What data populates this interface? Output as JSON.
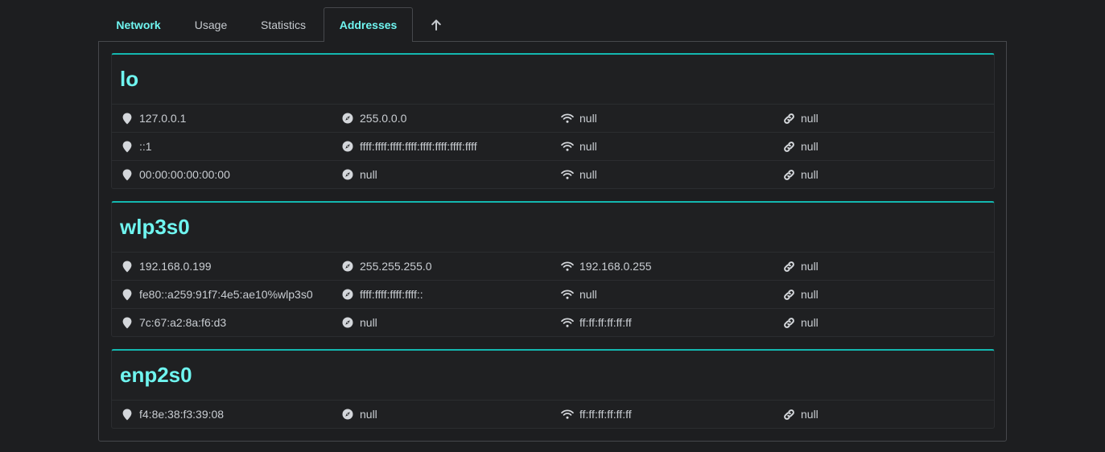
{
  "tabs": [
    {
      "label": "Network"
    },
    {
      "label": "Usage"
    },
    {
      "label": "Statistics"
    },
    {
      "label": "Addresses"
    }
  ],
  "interfaces": [
    {
      "name": "lo",
      "rows": [
        {
          "address": "127.0.0.1",
          "netmask": "255.0.0.0",
          "broadcast": "null",
          "ptp": "null"
        },
        {
          "address": "::1",
          "netmask": "ffff:ffff:ffff:ffff:ffff:ffff:ffff:ffff",
          "broadcast": "null",
          "ptp": "null"
        },
        {
          "address": "00:00:00:00:00:00",
          "netmask": "null",
          "broadcast": "null",
          "ptp": "null"
        }
      ]
    },
    {
      "name": "wlp3s0",
      "rows": [
        {
          "address": "192.168.0.199",
          "netmask": "255.255.255.0",
          "broadcast": "192.168.0.255",
          "ptp": "null"
        },
        {
          "address": "fe80::a259:91f7:4e5:ae10%wlp3s0",
          "netmask": "ffff:ffff:ffff:ffff::",
          "broadcast": "null",
          "ptp": "null"
        },
        {
          "address": "7c:67:a2:8a:f6:d3",
          "netmask": "null",
          "broadcast": "ff:ff:ff:ff:ff:ff",
          "ptp": "null"
        }
      ]
    },
    {
      "name": "enp2s0",
      "rows": [
        {
          "address": "f4:8e:38:f3:39:08",
          "netmask": "null",
          "broadcast": "ff:ff:ff:ff:ff:ff",
          "ptp": "null"
        }
      ]
    }
  ],
  "icons": {
    "address": "map-marker-icon",
    "netmask": "compass-icon",
    "broadcast": "wifi-icon",
    "ptp": "link-icon",
    "scroll_top": "arrow-up-icon"
  },
  "colors": {
    "accent": "#6ff5f0",
    "card_border": "#14b8b0",
    "background": "#1d1e20"
  }
}
